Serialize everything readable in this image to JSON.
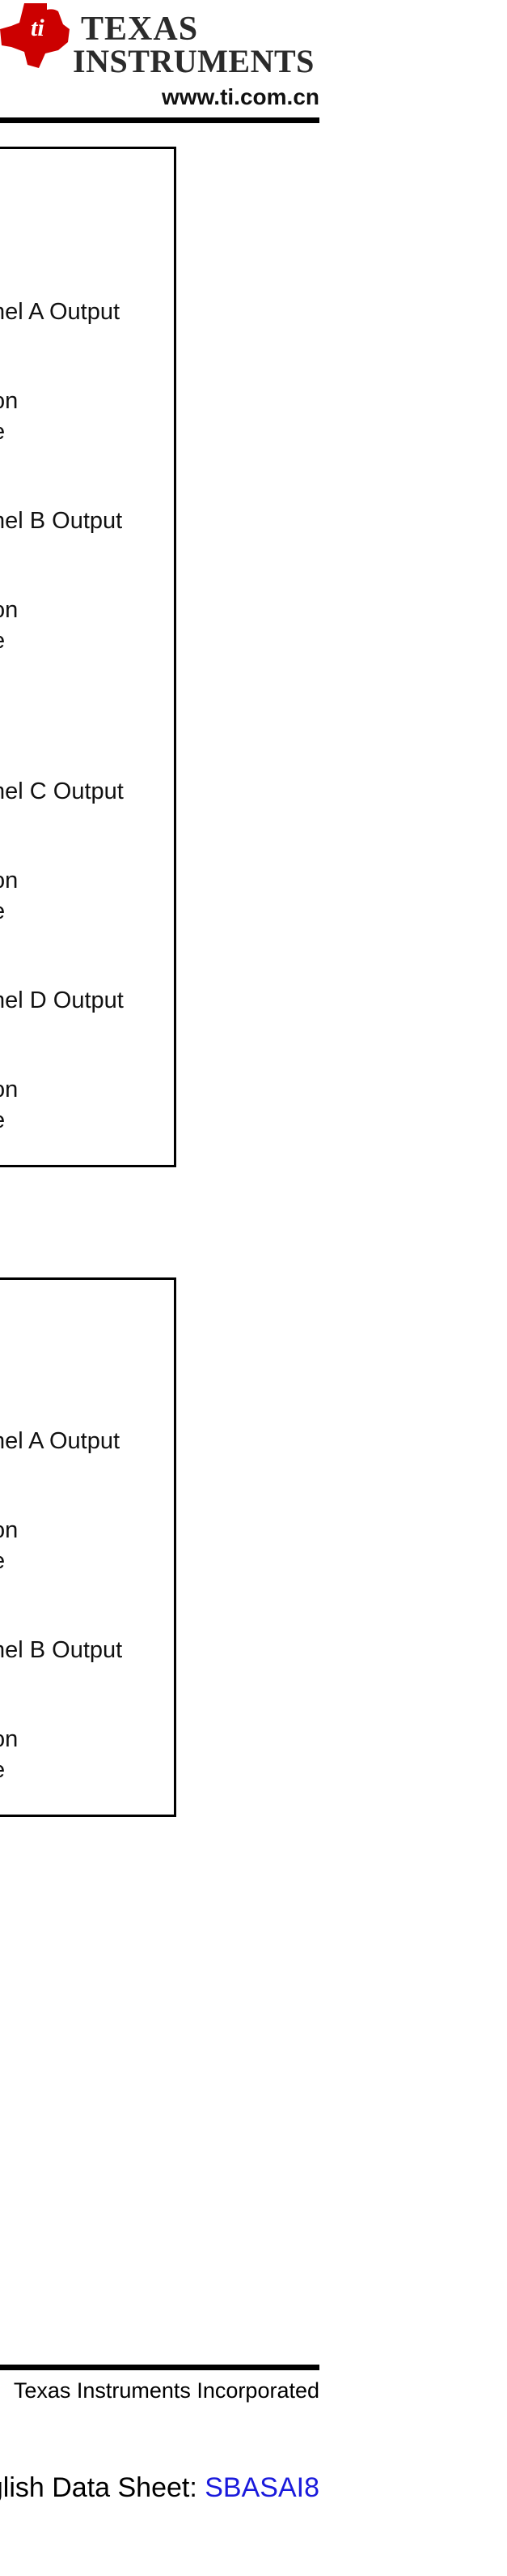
{
  "header": {
    "logo_icon": "ti-state-logo-icon",
    "brand_line1": "TEXAS",
    "brand_line2": "INSTRUMENTS",
    "url": "www.ti.com.cn",
    "colors": {
      "logo_red": "#cc0000",
      "text": "#2b2b2b"
    }
  },
  "diagram1": {
    "labels": [
      "nel A Output",
      "on",
      "e",
      "nel B Output",
      "on",
      "e",
      "nel C Output",
      "on",
      "e",
      "nel D Output",
      "on",
      "e"
    ]
  },
  "diagram2": {
    "labels": [
      "nel A Output",
      "on",
      "e",
      "nel B Output",
      "on",
      "e"
    ]
  },
  "footer": {
    "copyright": "Texas Instruments Incorporated",
    "english_prefix": "glish Data Sheet: ",
    "english_link": "SBASAI8",
    "link_color": "#1a1adc"
  }
}
